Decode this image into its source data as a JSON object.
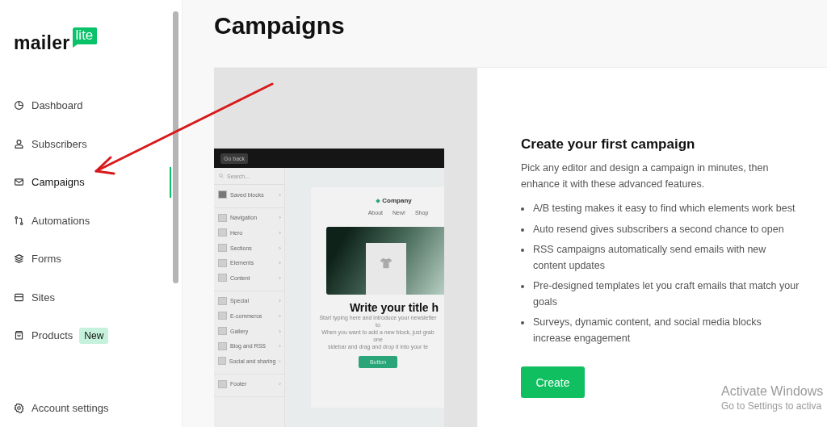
{
  "logo": {
    "word": "mailer",
    "tag": "lite"
  },
  "sidebar": {
    "items": [
      {
        "kind": "dashboard",
        "label": "Dashboard",
        "selected": false
      },
      {
        "kind": "subscribers",
        "label": "Subscribers",
        "selected": false
      },
      {
        "kind": "campaigns",
        "label": "Campaigns",
        "selected": true
      },
      {
        "kind": "automations",
        "label": "Automations",
        "selected": false
      },
      {
        "kind": "forms",
        "label": "Forms",
        "selected": false
      },
      {
        "kind": "sites",
        "label": "Sites",
        "selected": false
      },
      {
        "kind": "products",
        "label": "Products",
        "selected": false,
        "badge": "New"
      }
    ],
    "footer_items": [
      {
        "kind": "settings",
        "label": "Account settings",
        "selected": false
      }
    ]
  },
  "page": {
    "title": "Campaigns"
  },
  "preview": {
    "back_button": "Go back",
    "search_placeholder": "Search...",
    "block_groups": [
      [
        "Saved blocks"
      ],
      [
        "Navigation",
        "Hero",
        "Sections",
        "Elements",
        "Content"
      ],
      [
        "Special",
        "E-commerce",
        "Gallery",
        "Blog and RSS",
        "Social and sharing"
      ],
      [
        "Footer"
      ]
    ],
    "email": {
      "brand": "Company",
      "nav": [
        "About",
        "New!",
        "Shop"
      ],
      "title": "Write your title h",
      "body_lines": [
        "Start typing here and introduce your newsletter to",
        "When you want to add a new block, just grab one",
        "sidebar and drag and drop it into your te"
      ],
      "button": "Button"
    }
  },
  "intro": {
    "title": "Create your first campaign",
    "description": "Pick any editor and design a campaign in minutes, then enhance it with these advanced features.",
    "features": [
      "A/B testing makes it easy to find which elements work best",
      "Auto resend gives subscribers a second chance to open",
      "RSS campaigns automatically send emails with new content updates",
      "Pre-designed templates let you craft emails that match your goals",
      "Surveys, dynamic content, and social media blocks increase engagement"
    ],
    "button": "Create"
  },
  "os_notice": {
    "title": "Activate Windows",
    "subtitle": "Go to Settings to activa"
  }
}
